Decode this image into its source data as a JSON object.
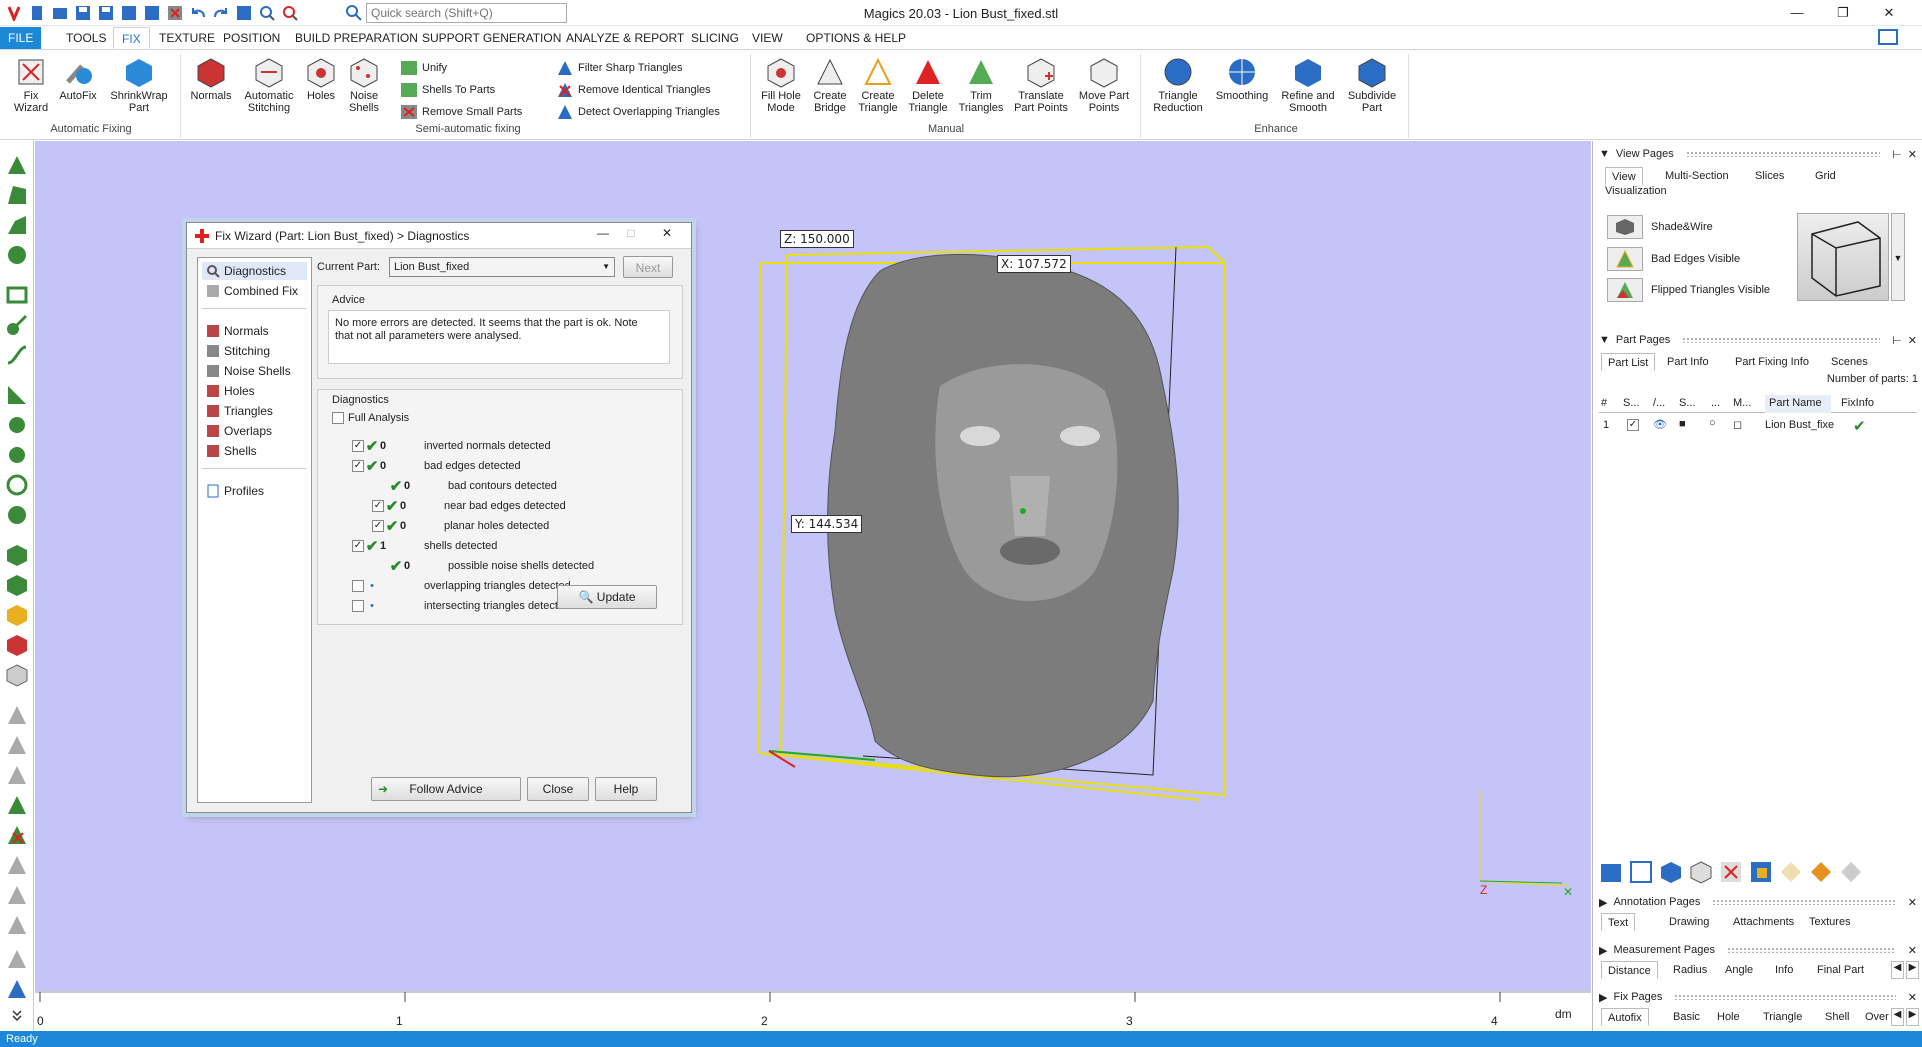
{
  "window": {
    "title": "Magics 20.03 - Lion Bust_fixed.stl"
  },
  "search": {
    "placeholder": "Quick search (Shift+Q)"
  },
  "menu": {
    "tabs": [
      "FILE",
      "TOOLS",
      "FIX",
      "TEXTURE",
      "POSITION",
      "BUILD PREPARATION",
      "SUPPORT GENERATION",
      "ANALYZE & REPORT",
      "SLICING",
      "VIEW",
      "OPTIONS & HELP"
    ],
    "active": "FIX"
  },
  "ribbon": {
    "auto_fixing": {
      "group": "Automatic Fixing",
      "buttons": [
        "Fix Wizard",
        "AutoFix",
        "ShrinkWrap Part"
      ]
    },
    "semi": {
      "group": "Semi-automatic fixing",
      "buttons": [
        "Normals",
        "Automatic Stitching",
        "Holes",
        "Noise Shells"
      ],
      "small": [
        "Unify",
        "Shells To Parts",
        "Remove Small Parts",
        "Filter Sharp Triangles",
        "Remove Identical Triangles",
        "Detect Overlapping Triangles"
      ]
    },
    "manual": {
      "group": "Manual",
      "buttons": [
        "Fill Hole Mode",
        "Create Bridge",
        "Create Triangle",
        "Delete Triangle",
        "Trim Triangles",
        "Translate Part Points",
        "Move Part Points"
      ]
    },
    "enhance": {
      "group": "Enhance",
      "buttons": [
        "Triangle Reduction",
        "Smoothing",
        "Refine and Smooth",
        "Subdivide Part"
      ]
    }
  },
  "dialog": {
    "title": "Fix Wizard (Part: Lion Bust_fixed) > Diagnostics",
    "nav_top": [
      "Diagnostics",
      "Combined Fix"
    ],
    "nav_mid": [
      "Normals",
      "Stitching",
      "Noise Shells",
      "Holes",
      "Triangles",
      "Overlaps",
      "Shells"
    ],
    "nav_bottom": [
      "Profiles"
    ],
    "current_part_label": "Current Part:",
    "current_part": "Lion Bust_fixed",
    "next": "Next",
    "advice_label": "Advice",
    "advice_text": "No more errors are detected. It seems that the part is ok. Note that not all parameters were analysed.",
    "diag_label": "Diagnostics",
    "full_analysis": "Full Analysis",
    "rows": [
      {
        "count": "0",
        "text": "inverted normals detected"
      },
      {
        "count": "0",
        "text": "bad edges detected"
      },
      {
        "count": "0",
        "text": "bad contours detected"
      },
      {
        "count": "0",
        "text": "near bad edges detected"
      },
      {
        "count": "0",
        "text": "planar holes detected"
      },
      {
        "count": "1",
        "text": "shells detected"
      },
      {
        "count": "0",
        "text": "possible noise shells detected"
      },
      {
        "count": "•",
        "text": "overlapping triangles detected"
      },
      {
        "count": "•",
        "text": "intersecting triangles detected"
      }
    ],
    "update": "Update",
    "follow_advice": "Follow Advice",
    "close": "Close",
    "help": "Help"
  },
  "viewport": {
    "z_label": "Z: 150.000",
    "x_label": "X: 107.572",
    "y_label": "Y: 144.534",
    "axis_z": "Z",
    "ruler_ticks": [
      "0",
      "1",
      "2",
      "3",
      "4"
    ],
    "ruler_unit": "dm"
  },
  "view_pages": {
    "title": "View Pages",
    "tabs": [
      "View",
      "Multi-Section",
      "Slices",
      "Grid"
    ],
    "visualization": "Visualization",
    "items": [
      "Shade&Wire",
      "Bad Edges Visible",
      "Flipped Triangles Visible"
    ]
  },
  "part_pages": {
    "title": "Part Pages",
    "tabs": [
      "Part List",
      "Part Info",
      "Part Fixing Info",
      "Scenes"
    ],
    "count": "Number of parts: 1",
    "cols": [
      "#",
      "S...",
      "/...",
      "S...",
      "...",
      "M...",
      "Part Name",
      "FixInfo"
    ],
    "row": {
      "num": "1",
      "name": "Lion Bust_fixe"
    }
  },
  "annotation_pages": {
    "title": "Annotation Pages",
    "tabs": [
      "Text",
      "Drawing",
      "Attachments",
      "Textures"
    ]
  },
  "measurement_pages": {
    "title": "Measurement Pages",
    "tabs": [
      "Distance",
      "Radius",
      "Angle",
      "Info",
      "Final Part"
    ]
  },
  "fix_pages": {
    "title": "Fix Pages",
    "tabs": [
      "Autofix",
      "Basic",
      "Hole",
      "Triangle",
      "Shell",
      "Over"
    ]
  },
  "status": "Ready"
}
